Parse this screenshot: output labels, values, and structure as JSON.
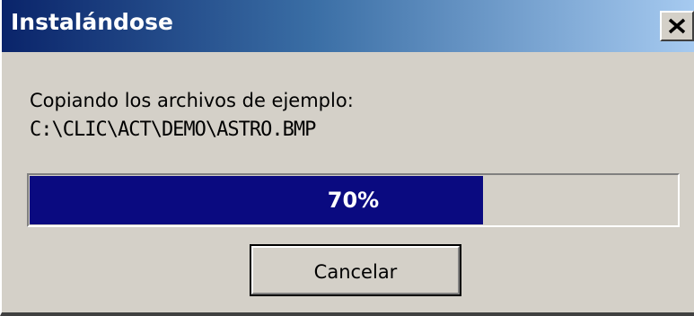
{
  "window": {
    "title": "Instalándose",
    "close_icon": "close-icon"
  },
  "message": {
    "line1": "Copiando los archivos de ejemplo:",
    "line2": "C:\\CLIC\\ACT\\DEMO\\ASTRO.BMP"
  },
  "progress": {
    "value": 70,
    "label": "70%",
    "fill_color": "#0a0a80"
  },
  "buttons": {
    "cancel_label": "Cancelar"
  }
}
